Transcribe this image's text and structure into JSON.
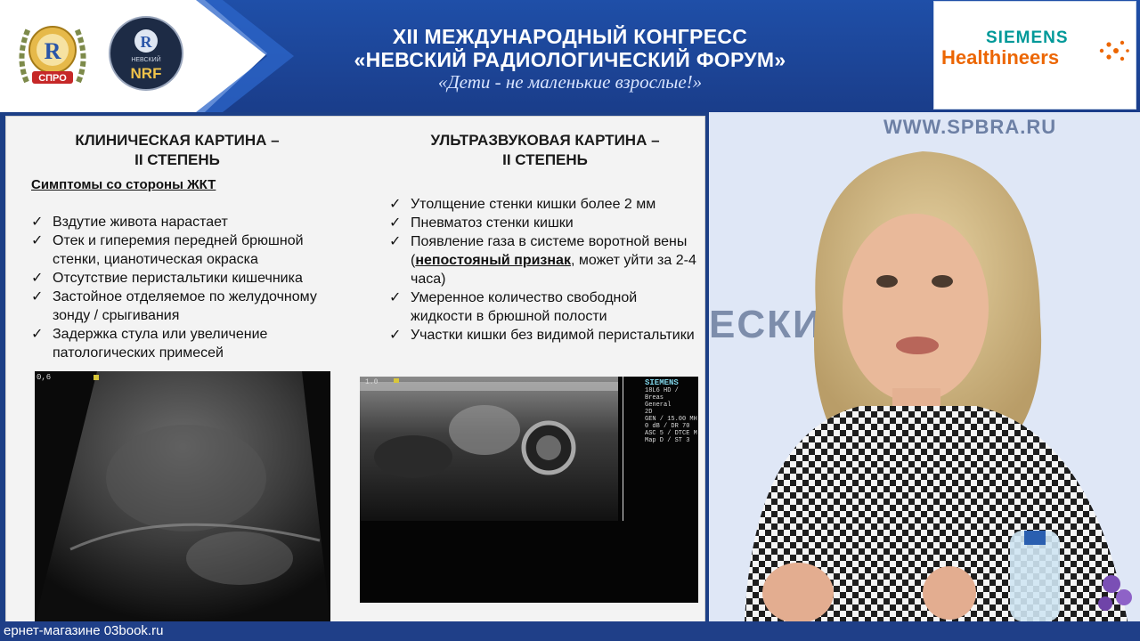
{
  "header": {
    "title_line1": "XII МЕЖДУНАРОДНЫЙ КОНГРЕСС",
    "title_line2": "«НЕВСКИЙ РАДИОЛОГИЧЕСКИЙ ФОРУМ»",
    "motto": "«Дети - не маленькие взрослые!»",
    "logo_spro": {
      "letter": "R",
      "label": "СПРО"
    },
    "logo_nrf": {
      "letter": "R",
      "small_line": "НЕВСКИЙ",
      "label": "NRF"
    },
    "sponsor": {
      "line1": "SIEMENS",
      "line2": "Healthineers"
    },
    "colors": {
      "header_blue": "#1f4fa8",
      "siemens_teal": "#009999",
      "healthineers_orange": "#ec6602"
    }
  },
  "slide": {
    "left": {
      "title_line1": "КЛИНИЧЕСКАЯ КАРТИНА –",
      "title_line2": "II СТЕПЕНЬ",
      "subheading": "Симптомы со стороны ЖКТ",
      "items": [
        "Вздутие живота нарастает",
        "Отек и гиперемия передней брюшной стенки, цианотическая окраска",
        "Отсутствие перистальтики кишечника",
        "Застойное отделяемое по желудочному зонду / срыгивания",
        "Задержка стула или увеличение патологических примесей"
      ]
    },
    "right": {
      "title_line1": "УЛЬТРАЗВУКОВАЯ КАРТИНА –",
      "title_line2": "II СТЕПЕНЬ",
      "items": [
        "Утолщение стенки кишки более 2 мм",
        "Пневматоз стенки кишки",
        "Умеренное количество свободной жидкости в брюшной полости",
        "Участки кишки без видимой перистальтики"
      ],
      "portal_gas": {
        "before": "Появление газа в системе воротной вены (",
        "emphasis": "непостояный признак",
        "after": ", может уйти за 2-4 часа)"
      }
    },
    "us_left_label": "0,6",
    "us_right": {
      "depth": "1.0",
      "brand": "SIEMENS",
      "lines": [
        "18L6 HD / Breas",
        "General",
        "2D",
        "GEN / 15.00 MH",
        "0 dB / DR 70",
        "ASC 5 / DTCE M",
        "Map D / ST 3"
      ]
    }
  },
  "video": {
    "url": "WWW.SPBRA.RU",
    "wall_text": "ЕСКИЙ"
  },
  "ticker": {
    "text": "ернет-магазине 03book.ru"
  }
}
